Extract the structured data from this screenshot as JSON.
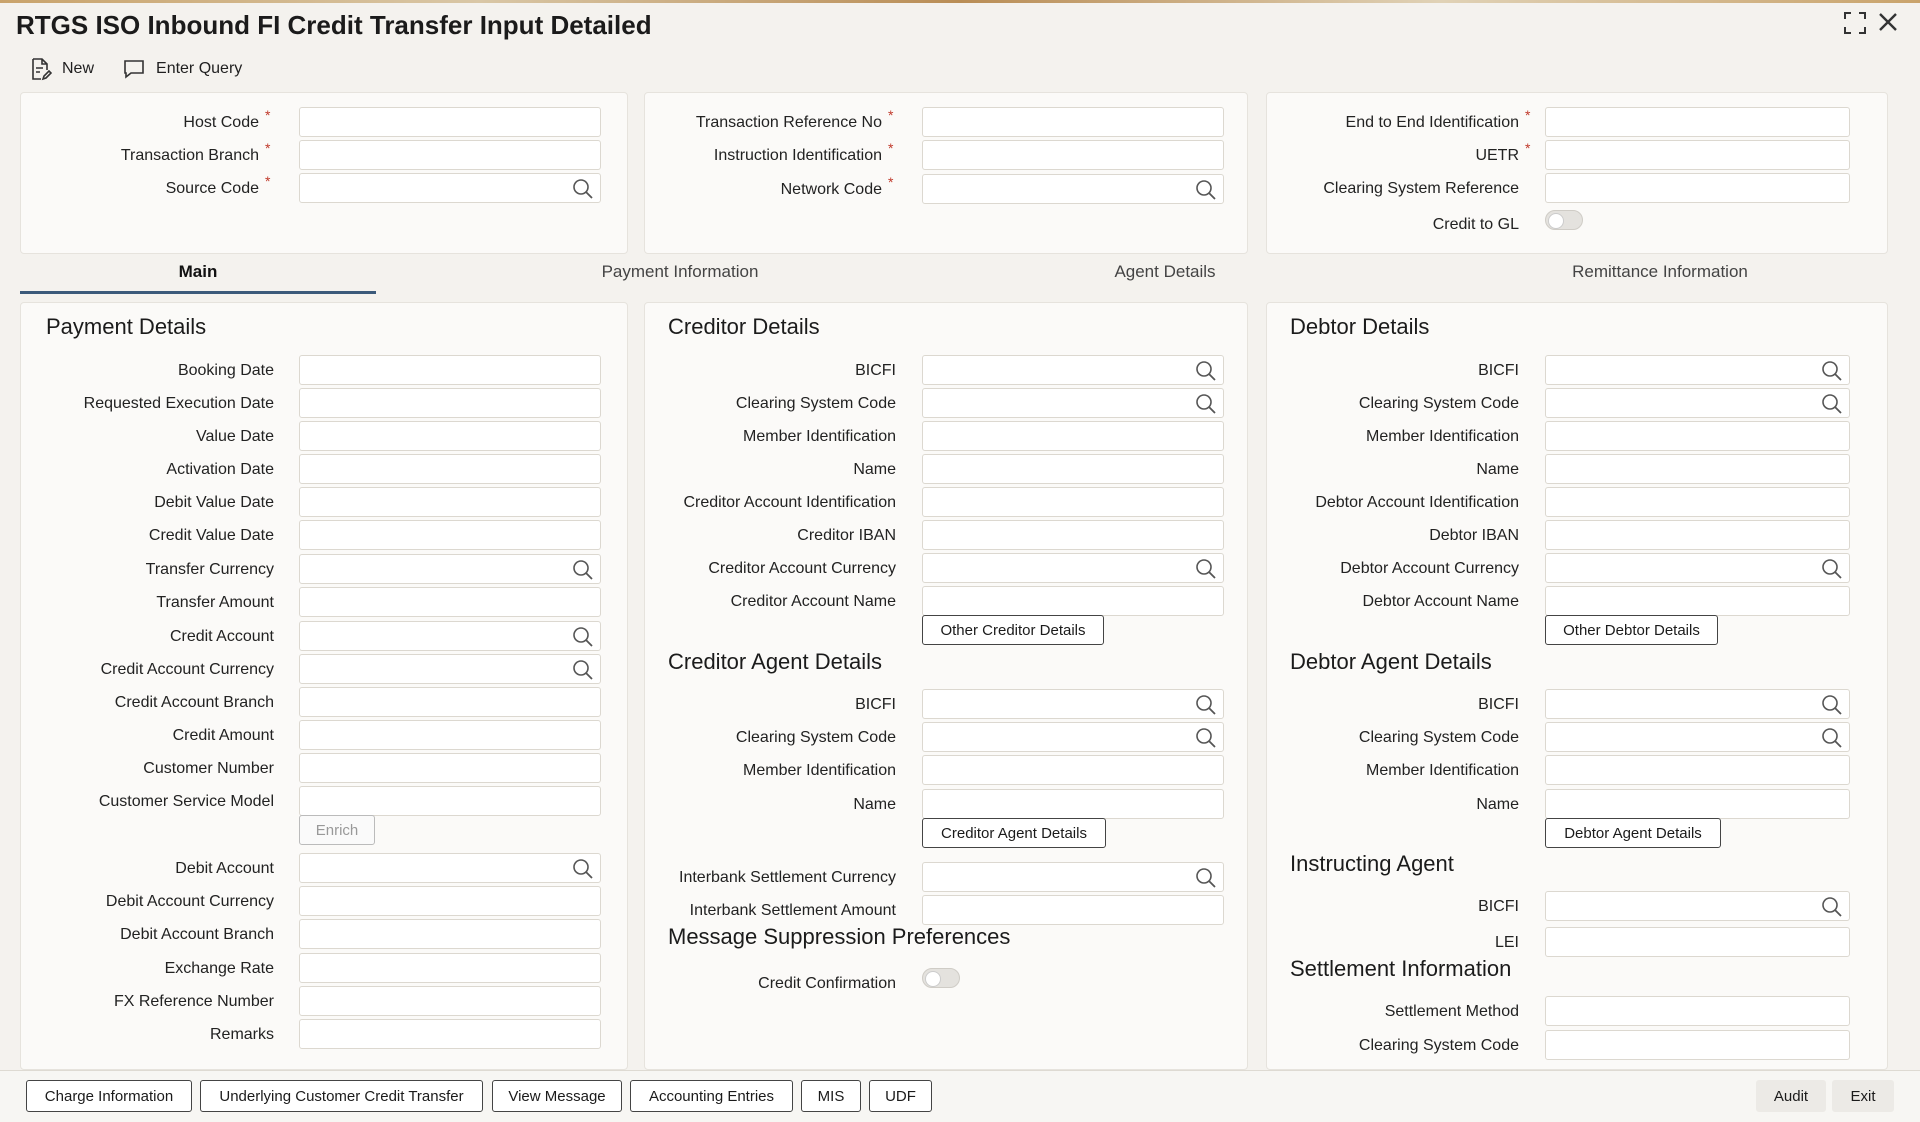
{
  "window": {
    "title": "RTGS ISO Inbound FI Credit Transfer Input Detailed"
  },
  "toolbar": {
    "new_label": "New",
    "enter_query_label": "Enter Query"
  },
  "header": {
    "host_code": "Host Code",
    "transaction_branch": "Transaction Branch",
    "source_code": "Source Code",
    "transaction_reference_no": "Transaction Reference No",
    "instruction_identification": "Instruction Identification",
    "network_code": "Network Code",
    "end_to_end_identification": "End to End Identification",
    "uetr": "UETR",
    "clearing_system_reference": "Clearing System Reference",
    "credit_to_gl": "Credit to GL",
    "required_mark": "*"
  },
  "tabs": [
    {
      "label": "Main"
    },
    {
      "label": "Payment Information"
    },
    {
      "label": "Agent Details"
    },
    {
      "label": "Remittance Information"
    }
  ],
  "payment_details": {
    "title": "Payment Details",
    "fields": [
      "Booking Date",
      "Requested Execution Date",
      "Value Date",
      "Activation Date",
      "Debit Value Date",
      "Credit Value Date",
      "Transfer Currency",
      "Transfer Amount",
      "Credit Account",
      "Credit Account Currency",
      "Credit Account Branch",
      "Credit Amount",
      "Customer Number",
      "Customer Service Model"
    ],
    "enrich_label": "Enrich",
    "fields2": [
      "Debit Account",
      "Debit Account Currency",
      "Debit Account Branch",
      "Exchange Rate",
      "FX Reference Number",
      "Remarks"
    ]
  },
  "creditor_details": {
    "title": "Creditor Details",
    "fields": [
      "BICFI",
      "Clearing System Code",
      "Member Identification",
      "Name",
      "Creditor Account Identification",
      "Creditor IBAN",
      "Creditor Account Currency",
      "Creditor Account Name"
    ],
    "button_label": "Other Creditor Details"
  },
  "creditor_agent": {
    "title": "Creditor Agent Details",
    "fields": [
      "BICFI",
      "Clearing System Code",
      "Member Identification",
      "Name"
    ],
    "button_label": "Creditor Agent Details",
    "interbank_currency": "Interbank Settlement Currency",
    "interbank_amount": "Interbank Settlement Amount"
  },
  "message_suppression": {
    "title": "Message Suppression Preferences",
    "credit_confirmation": "Credit Confirmation"
  },
  "debtor_details": {
    "title": "Debtor Details",
    "fields": [
      "BICFI",
      "Clearing System Code",
      "Member Identification",
      "Name",
      "Debtor Account Identification",
      "Debtor IBAN",
      "Debtor Account Currency",
      "Debtor Account Name"
    ],
    "button_label": "Other Debtor Details"
  },
  "debtor_agent": {
    "title": "Debtor Agent Details",
    "fields": [
      "BICFI",
      "Clearing System Code",
      "Member Identification",
      "Name"
    ],
    "button_label": "Debtor Agent Details"
  },
  "instructing_agent": {
    "title": "Instructing Agent",
    "fields": [
      "BICFI",
      "LEI"
    ]
  },
  "settlement": {
    "title": "Settlement Information",
    "fields": [
      "Settlement Method",
      "Clearing System Code"
    ]
  },
  "footer": {
    "charge_information": "Charge Information",
    "underlying_transfer": "Underlying Customer Credit Transfer",
    "view_message": "View Message",
    "accounting_entries": "Accounting Entries",
    "mis": "MIS",
    "udf": "UDF",
    "audit": "Audit",
    "exit": "Exit"
  },
  "colors": {
    "accent": "#3b5a7a",
    "required": "#c0392b"
  }
}
